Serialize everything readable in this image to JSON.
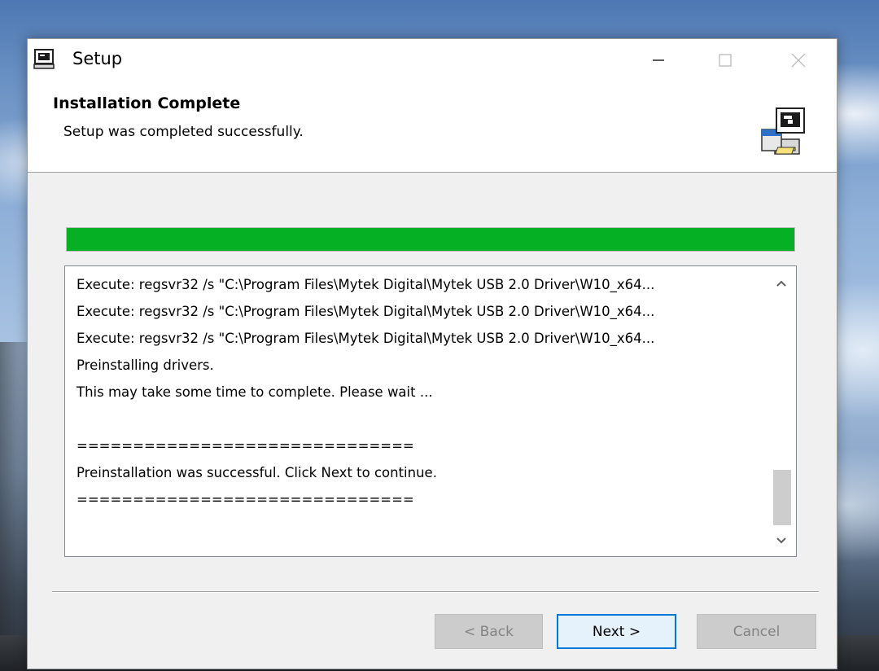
{
  "window": {
    "title": "Setup",
    "min_glyph": "—",
    "max_glyph": "☐",
    "close_glyph": "✕"
  },
  "header": {
    "title": "Installation Complete",
    "subtitle": "Setup was completed successfully.",
    "icon": "setup-computer-icon"
  },
  "progress": {
    "value_percent": 100,
    "color": "#06b025"
  },
  "log": {
    "lines": [
      "Execute: regsvr32 /s \"C:\\Program Files\\Mytek Digital\\Mytek USB 2.0 Driver\\W10_x64...",
      "Execute: regsvr32 /s \"C:\\Program Files\\Mytek Digital\\Mytek USB 2.0 Driver\\W10_x64...",
      "Execute: regsvr32 /s \"C:\\Program Files\\Mytek Digital\\Mytek USB 2.0 Driver\\W10_x64...",
      "Preinstalling drivers.",
      "This may take some time to complete. Please wait ...",
      "",
      "==============================",
      "Preinstallation was successful. Click Next to continue.",
      "=============================="
    ],
    "scroll_up_glyph": "⌃",
    "scroll_down_glyph": "⌄"
  },
  "buttons": {
    "back": "< Back",
    "next": "Next >",
    "cancel": "Cancel"
  },
  "colors": {
    "accent": "#0078d7",
    "progress": "#06b025"
  }
}
